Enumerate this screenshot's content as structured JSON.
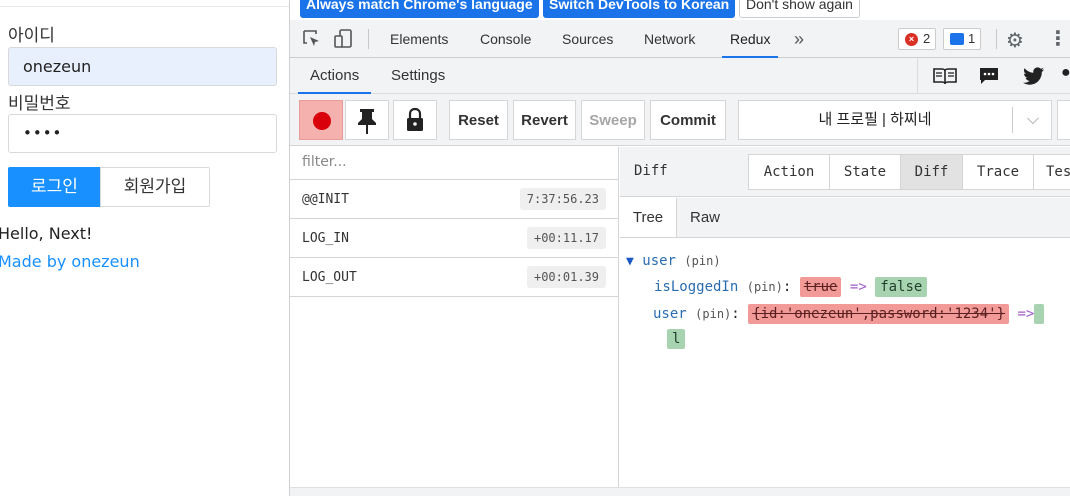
{
  "page": {
    "id_label": "아이디",
    "id_value": "onezeun",
    "pw_label": "비밀번호",
    "pw_value": "••••",
    "login_button": "로그인",
    "signup_button": "회원가입",
    "hello_text": "Hello, Next!",
    "made_by_link": "Made by onezeun"
  },
  "infobar": {
    "match_language": "Always match Chrome's language",
    "switch_korean": "Switch DevTools to Korean",
    "dont_show": "Don't show again"
  },
  "devtools": {
    "tabs": [
      "Elements",
      "Console",
      "Sources",
      "Network",
      "Redux"
    ],
    "active_tab": "Redux",
    "more_tabs_glyph": "»",
    "error_count": "2",
    "message_count": "1"
  },
  "redux": {
    "subtabs": {
      "actions": "Actions",
      "settings": "Settings"
    },
    "toolbar": {
      "reset": "Reset",
      "revert": "Revert",
      "sweep": "Sweep",
      "commit": "Commit",
      "instance": "내 프로필 | 하찌네",
      "dropdown_glyph": "⌵"
    },
    "filter_placeholder": "filter...",
    "actions": [
      {
        "name": "@@INIT",
        "time": "7:37:56.23"
      },
      {
        "name": "LOG_IN",
        "time": "+00:11.17"
      },
      {
        "name": "LOG_OUT",
        "time": "+00:01.39"
      }
    ],
    "detail": {
      "title": "Diff",
      "tabs": [
        "Action",
        "State",
        "Diff",
        "Trace",
        "Tes"
      ],
      "active_tab": "Diff",
      "view_tabs": {
        "tree": "Tree",
        "raw": "Raw"
      },
      "tree": {
        "root_key": "user",
        "pin": "(pin)",
        "is_logged_in_key": "isLoggedIn",
        "is_logged_in_old": "true",
        "is_logged_in_new": "false",
        "user_key": "user",
        "user_old": "{id:'onezeun',password:'1234'}",
        "user_new": "l",
        "arrow": "=>",
        "colon": ":",
        "expand_glyph": "▼"
      }
    }
  }
}
